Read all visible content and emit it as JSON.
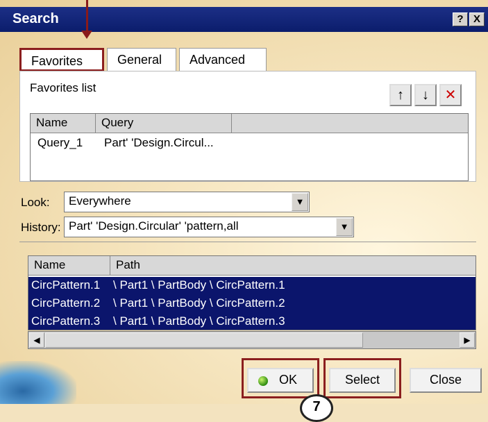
{
  "window": {
    "title": "Search",
    "help_label": "?",
    "close_label": "X"
  },
  "tabs": [
    {
      "label": "Favorites",
      "active": true
    },
    {
      "label": "General",
      "active": false
    },
    {
      "label": "Advanced",
      "active": false
    }
  ],
  "favorites": {
    "label": "Favorites list",
    "up_label": "↑",
    "down_label": "↓",
    "delete_label": "✕",
    "columns": [
      "Name",
      "Query"
    ],
    "rows": [
      {
        "name": "Query_1",
        "query": "Part' 'Design.Circul..."
      }
    ]
  },
  "look": {
    "label": "Look:",
    "value": "Everywhere"
  },
  "history": {
    "label": "History:",
    "value": "Part' 'Design.Circular' 'pattern,all"
  },
  "results": {
    "columns": [
      "Name",
      "Path"
    ],
    "rows": [
      {
        "name": "CircPattern.1",
        "path": "\\ Part1 \\ PartBody \\ CircPattern.1"
      },
      {
        "name": "CircPattern.2",
        "path": "\\ Part1 \\ PartBody \\ CircPattern.2"
      },
      {
        "name": "CircPattern.3",
        "path": "\\ Part1 \\ PartBody \\ CircPattern.3"
      }
    ]
  },
  "buttons": {
    "ok": "OK",
    "select": "Select",
    "close": "Close"
  },
  "step_number": "7",
  "colors": {
    "highlight": "#8b1e1e",
    "title_bar": "#0b1d6c",
    "selection": "#0b156c"
  },
  "icons": [
    "arrow-up-icon",
    "arrow-down-icon",
    "delete-icon",
    "ok-green-dot-icon"
  ]
}
